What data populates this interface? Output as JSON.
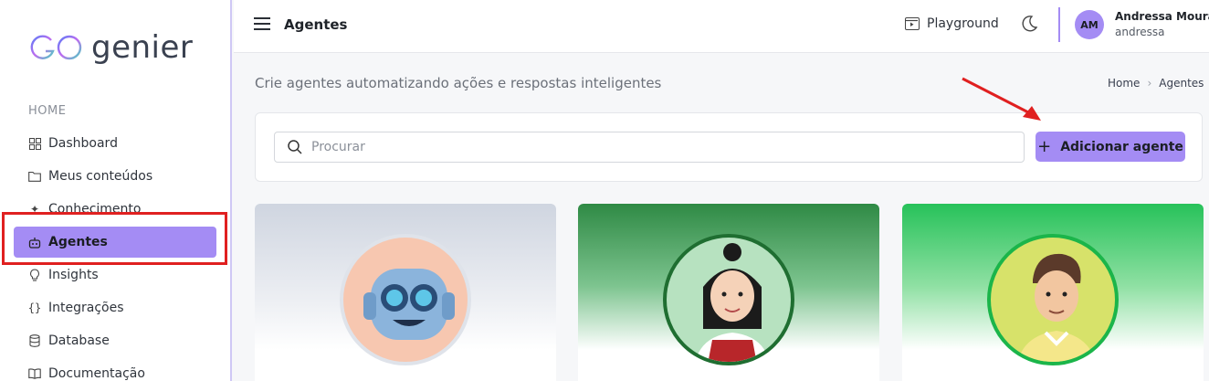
{
  "sidebar": {
    "logo_text": "genier",
    "section_label": "HOME",
    "items": [
      {
        "label": "Dashboard",
        "icon": "grid-icon"
      },
      {
        "label": "Meus conteúdos",
        "icon": "folder-icon"
      },
      {
        "label": "Conhecimento",
        "icon": "sparkle-icon"
      },
      {
        "label": "Agentes",
        "icon": "robot-icon",
        "active": true
      },
      {
        "label": "Insights",
        "icon": "bulb-icon"
      },
      {
        "label": "Integrações",
        "icon": "braces-icon"
      },
      {
        "label": "Database",
        "icon": "database-icon"
      },
      {
        "label": "Documentação",
        "icon": "book-icon"
      }
    ]
  },
  "header": {
    "title": "Agentes",
    "playground_label": "Playground",
    "user": {
      "initials": "AM",
      "name": "Andressa Moura",
      "login": "andressa"
    }
  },
  "main": {
    "subtitle": "Crie agentes automatizando ações e respostas inteligentes",
    "breadcrumb": [
      "Home",
      "Agentes"
    ],
    "search": {
      "placeholder": "Procurar",
      "value": ""
    },
    "add_button_label": "Adicionar agente",
    "cards": [
      {
        "avatar": "robot-avatar"
      },
      {
        "avatar": "woman-avatar"
      },
      {
        "avatar": "man-avatar"
      }
    ]
  },
  "colors": {
    "accent": "#a48cf4",
    "annotation": "#e02020"
  }
}
